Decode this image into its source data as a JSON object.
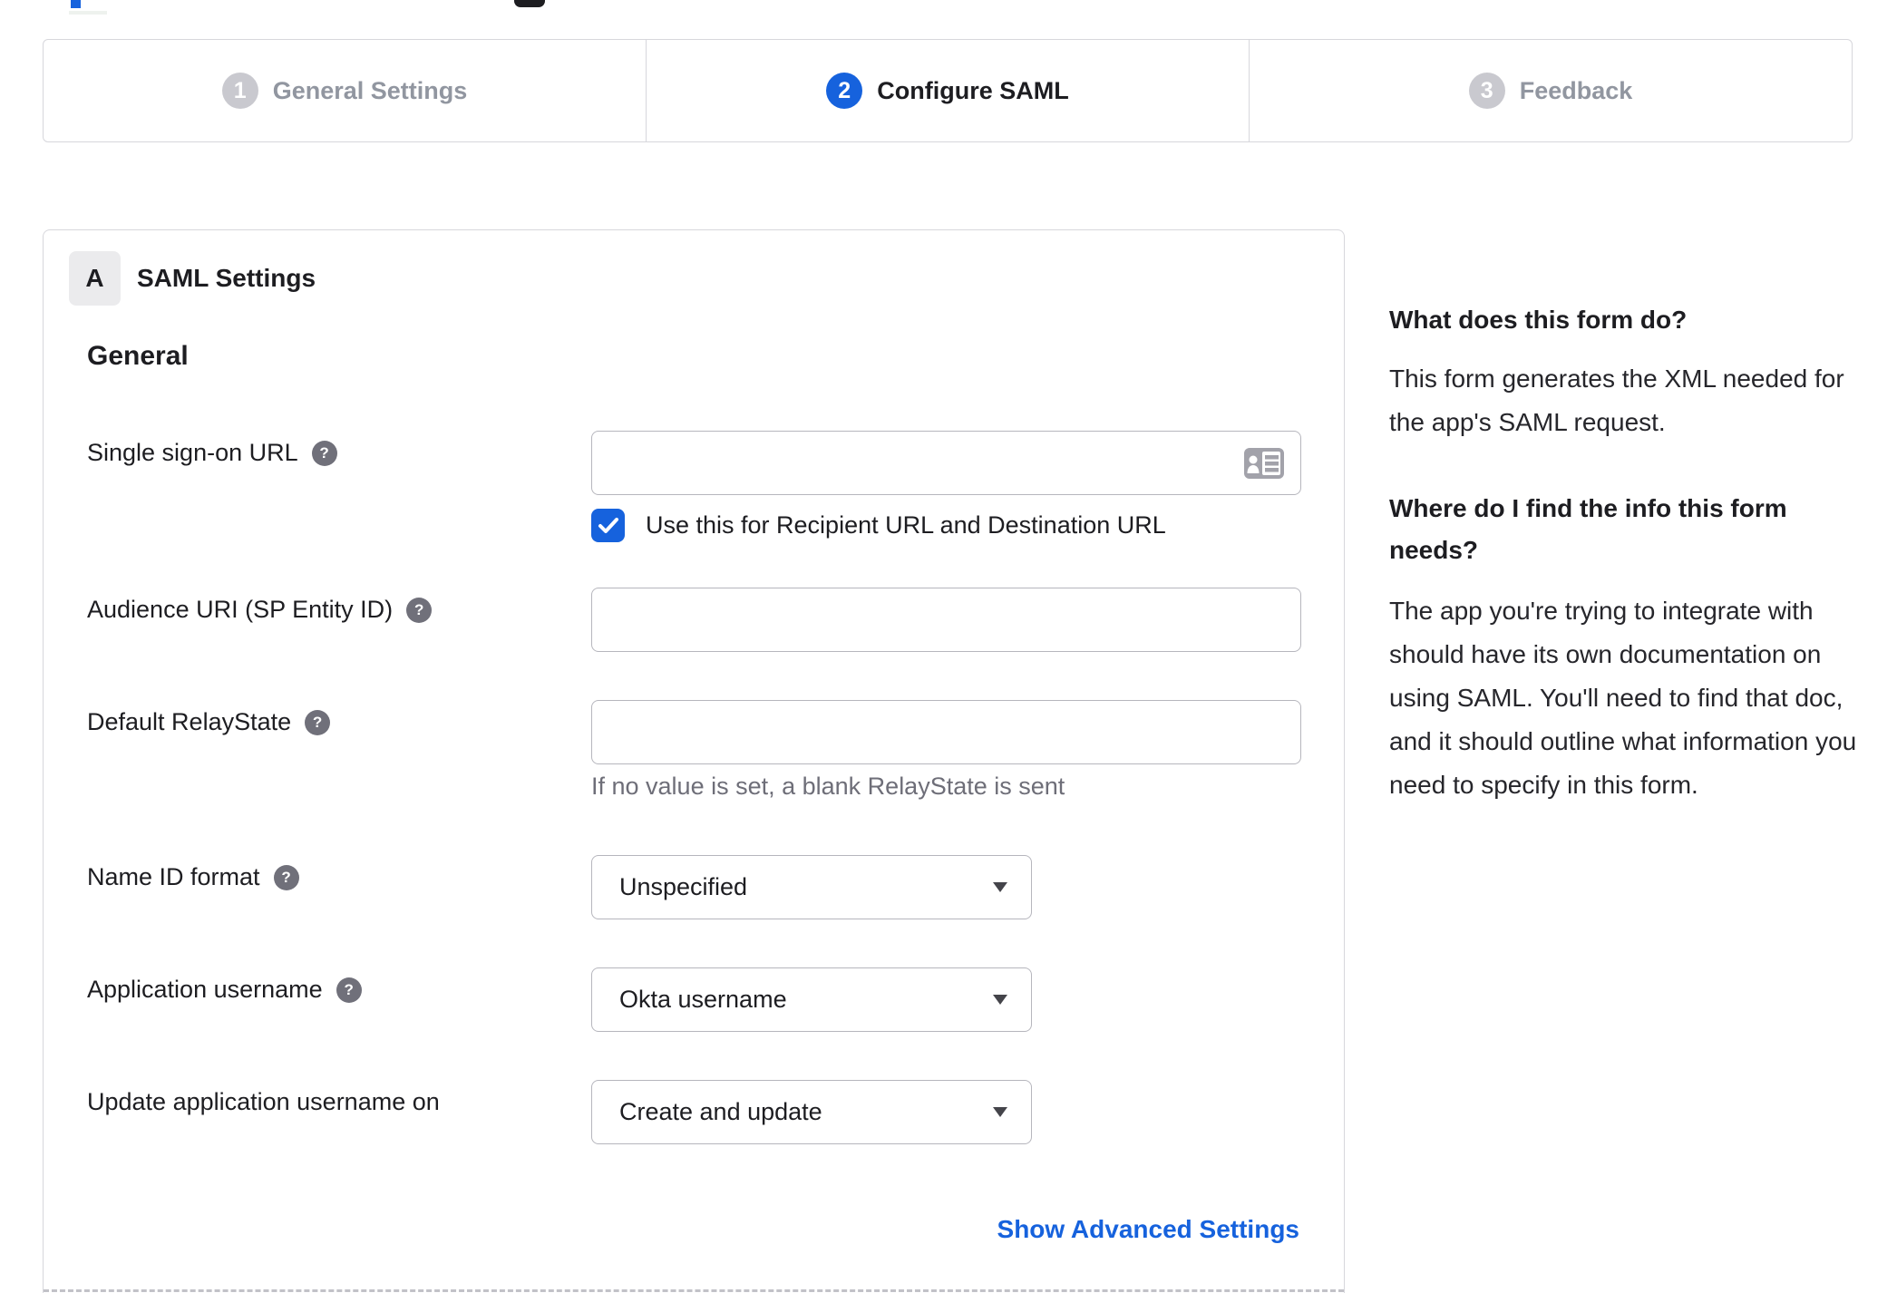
{
  "colors": {
    "accent": "#1662dd",
    "text": "#1d1d21",
    "muted_text": "#6e6e78",
    "inactive_step": "#9196a0",
    "border": "#d7d7dc"
  },
  "stepper": {
    "steps": [
      {
        "number": "1",
        "label": "General Settings",
        "state": "inactive"
      },
      {
        "number": "2",
        "label": "Configure SAML",
        "state": "active"
      },
      {
        "number": "3",
        "label": "Feedback",
        "state": "inactive"
      }
    ]
  },
  "saml_panel": {
    "badge": "A",
    "title": "SAML Settings",
    "section_heading": "General",
    "fields": {
      "sso": {
        "label": "Single sign-on URL",
        "value": "",
        "checkbox_label": "Use this for Recipient URL and Destination URL",
        "checkbox_checked": true
      },
      "audience": {
        "label": "Audience URI (SP Entity ID)",
        "value": ""
      },
      "relay": {
        "label": "Default RelayState",
        "value": "",
        "helper": "If no value is set, a blank RelayState is sent"
      },
      "name_id": {
        "label": "Name ID format",
        "value": "Unspecified"
      },
      "app_username": {
        "label": "Application username",
        "value": "Okta username"
      },
      "update_username": {
        "label": "Update application username on",
        "value": "Create and update"
      }
    },
    "advanced_link": "Show Advanced Settings"
  },
  "help_panel": {
    "q1": "What does this form do?",
    "a1": "This form generates the XML needed for the app's SAML request.",
    "q2": "Where do I find the info this form needs?",
    "a2": "The app you're trying to integrate with should have its own documentation on using SAML. You'll need to find that doc, and it should outline what information you need to specify in this form."
  },
  "icons": {
    "help": "?"
  }
}
